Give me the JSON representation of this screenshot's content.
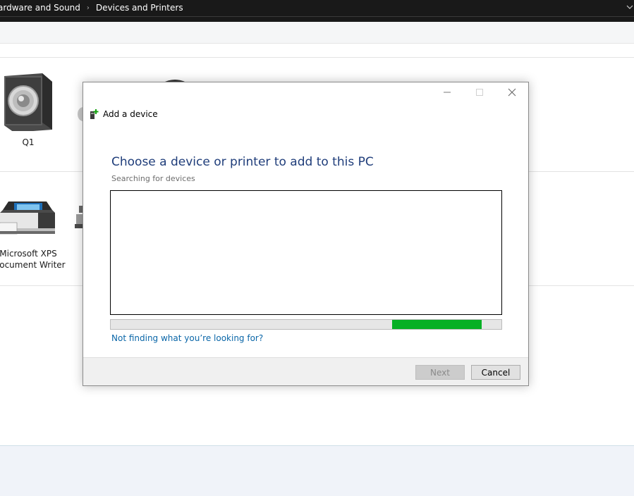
{
  "breadcrumb": {
    "part1": "ardware and Sound",
    "separator": "›",
    "part2": "Devices and Printers",
    "dropdown": "⌄"
  },
  "devices": [
    {
      "label": "Q1"
    },
    {
      "label_line1": "Microsoft XPS",
      "label_line2": "Document Writer"
    }
  ],
  "dialog": {
    "title": "Add a device",
    "minimize_glyph": "—",
    "maximize_glyph": "☐",
    "close_glyph": "✕",
    "instruction": "Choose a device or printer to add to this PC",
    "status": "Searching for devices",
    "progress": {
      "segment_start": 0.72,
      "segment_end": 0.95,
      "color": "#06b025"
    },
    "help_link": "Not finding what you’re looking for?",
    "next_label": "Next",
    "cancel_label": "Cancel"
  },
  "colors": {
    "instruction": "#1f3d7a",
    "link": "#0a66a8",
    "addressbar": "#191919"
  }
}
